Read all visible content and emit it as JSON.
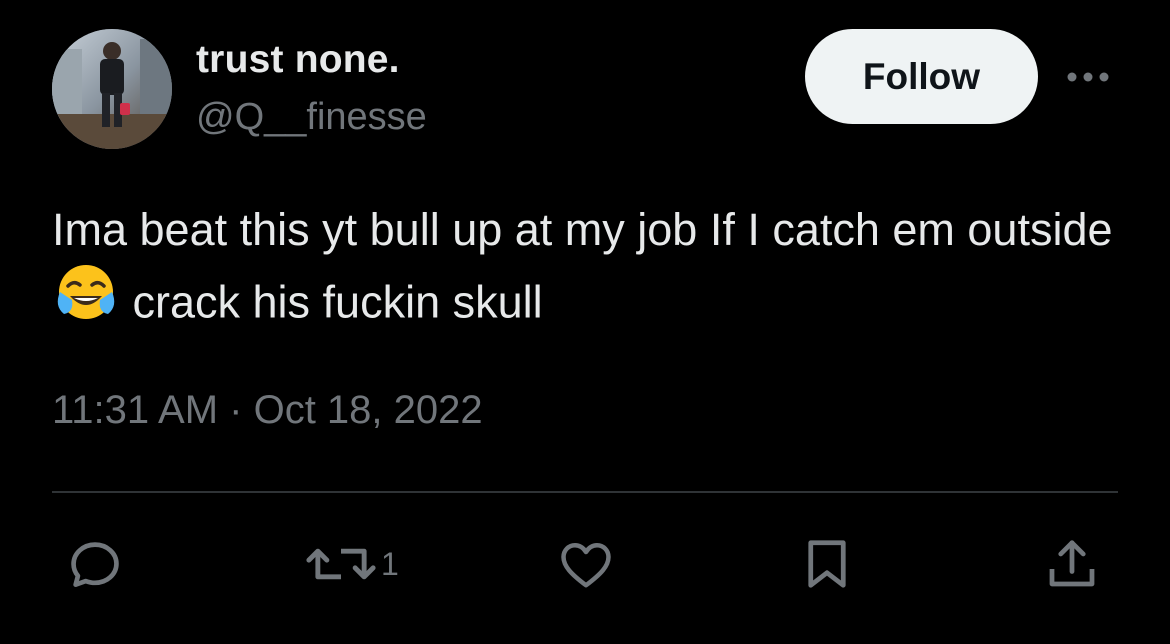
{
  "author": {
    "display_name": "trust none.",
    "handle": "@Q__finesse"
  },
  "follow_button": {
    "label": "Follow"
  },
  "more_icon": "more-horizontal-icon",
  "tweet": {
    "text_before_emoji": "Ima beat this yt bull up at my job If I catch em outside ",
    "emoji": "face-with-tears-of-joy",
    "text_after_emoji": " crack his fuckin skull",
    "timestamp": "11:31 AM · Oct 18, 2022"
  },
  "actions": {
    "reply_icon": "reply-icon",
    "retweet_icon": "retweet-icon",
    "retweet_count": "1",
    "like_icon": "heart-icon",
    "bookmark_icon": "bookmark-icon",
    "share_icon": "share-icon"
  },
  "colors": {
    "background": "#000000",
    "primary_text": "#e7e9ea",
    "secondary_text": "#71767b",
    "divider": "#2f3336",
    "follow_bg": "#eff3f4",
    "follow_text": "#0f1419"
  }
}
